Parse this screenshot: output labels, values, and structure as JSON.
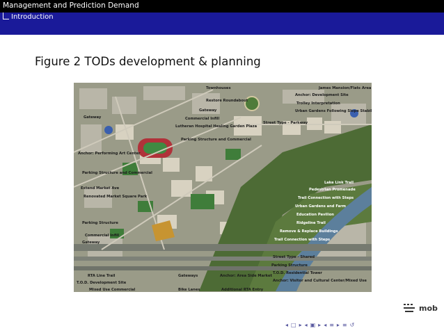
{
  "header": {
    "section": "Management and Prediction Demand",
    "subsection": "Introduction"
  },
  "slide": {
    "title": "Figure 2 TODs development & planning"
  },
  "map": {
    "labels": [
      "Townhouses",
      "James Mansion/Flats Area",
      "Anchor: Development Site",
      "Restore Roundabout",
      "Trolley Interpretation",
      "Urban Gardens Following Slope Stabilization",
      "Gateway",
      "Gateway",
      "Commercial Infill",
      "Lutheran Hospital Healing Garden Plaza",
      "Street Type - Parkway",
      "Parking Structure and Commercial",
      "Anchor: Performing Art Center",
      "Parking Structure and Commercial",
      "Extend Market Ave",
      "Renovated Market Square Park",
      "Lake Link Trail",
      "Pedestrian Promenade",
      "Trail Connection with Steps",
      "Urban Gardens and Farm",
      "Education Pavilion",
      "Ridgeline Trail",
      "Remove & Replace Buildings",
      "Trail Connection with Steps",
      "Parking Structure",
      "Commercial Infill",
      "Gateway",
      "Street Type - Shared",
      "Parking Structure",
      "T.O.D. Residential Tower",
      "Anchor: Visitor and Cultural Center/Mixed Use",
      "RTA Line Trail",
      "T.O.D. Development Site",
      "Mixed Use Commercial",
      "Gateways",
      "Bike Lanes",
      "Anchor: Area Side Market",
      "Additional RTA Entry"
    ]
  },
  "logo": {
    "text": "mob"
  },
  "navigation": {
    "icons": [
      "nav-left-icon",
      "nav-right-icon",
      "frame-left-icon",
      "frame-right-icon",
      "subsection-left-icon",
      "subsection-right-icon",
      "section-left-icon",
      "section-right-icon",
      "align-icon",
      "search-icon"
    ]
  }
}
